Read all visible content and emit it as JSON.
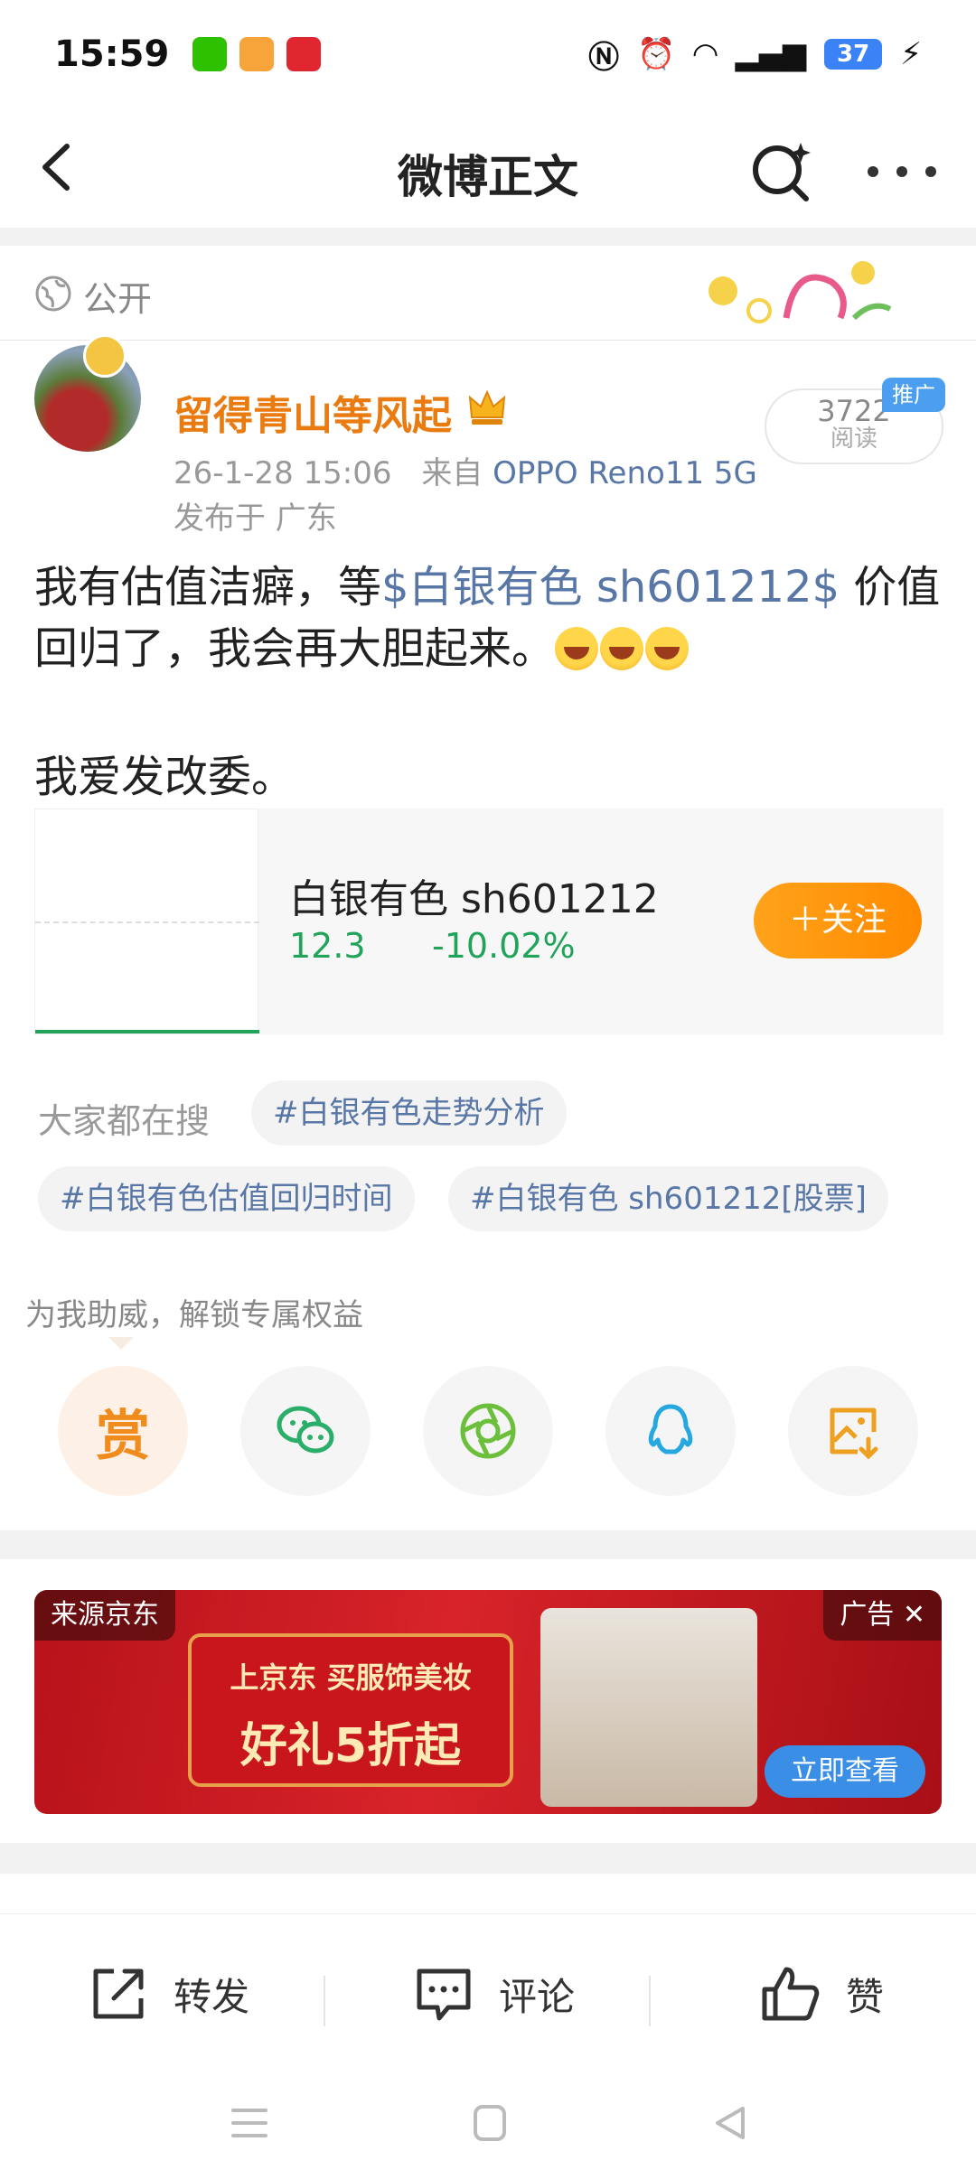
{
  "status_bar": {
    "time": "15:59",
    "apps": [
      "wechat-icon",
      "app-orange-icon",
      "app-red-icon"
    ],
    "icons": [
      "nfc-icon",
      "alarm-icon",
      "wifi-icon",
      "signal-5g-icon"
    ],
    "battery": "37"
  },
  "nav": {
    "title": "微博正文"
  },
  "visibility": {
    "label": "公开"
  },
  "author": {
    "name": "留得青山等风起",
    "timestamp": "26-1-28 15:06",
    "source_prefix": "来自",
    "device": "OPPO Reno11 5G",
    "location": "发布于 广东"
  },
  "reads": {
    "count": "3722",
    "label": "阅读",
    "promo": "推广"
  },
  "post": {
    "text_before": "我有估值洁癖，等",
    "stock_link": "$白银有色 sh601212$",
    "text_after": " 价值回归了，我会再大胆起来。",
    "line2": "我爱发改委。"
  },
  "stock": {
    "name": "白银有色 sh601212",
    "price": "12.3",
    "change": "-10.02%",
    "follow": "＋关注",
    "color": "#21a45a"
  },
  "search": {
    "label": "大家都在搜",
    "tags": [
      "#白银有色走势分析",
      "#白银有色估值回归时间",
      "#白银有色 sh601212[股票]"
    ]
  },
  "support": {
    "label": "为我助威，解锁专属权益",
    "reward": "赏",
    "buttons": [
      "reward-button",
      "wechat-share-button",
      "moments-share-button",
      "qq-share-button",
      "save-image-button"
    ]
  },
  "ad": {
    "source": "来源京东",
    "tag": "广告 ✕",
    "headline": "上京东 买服饰美妆",
    "offer": "好礼5折起",
    "cta": "立即查看"
  },
  "actions": {
    "repost": "转发",
    "comment": "评论",
    "like": "赞"
  },
  "colors": {
    "accent": "#ff8a00",
    "link": "#5876a6",
    "author": "#ea7b10"
  }
}
